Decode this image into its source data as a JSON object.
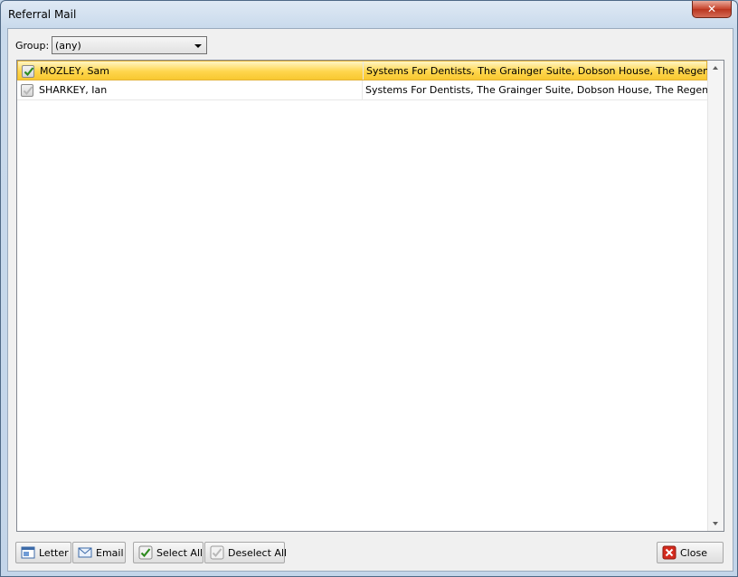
{
  "window": {
    "title": "Referral Mail",
    "close_glyph": "✕"
  },
  "filter": {
    "label": "Group:",
    "selected": "(any)"
  },
  "list": {
    "rows": [
      {
        "checked": true,
        "selected": true,
        "name": "MOZLEY, Sam",
        "address": "Systems For Dentists, The Grainger Suite, Dobson House, The Regent"
      },
      {
        "checked": false,
        "selected": false,
        "name": "SHARKEY, Ian",
        "address": "Systems For Dentists, The Grainger Suite, Dobson House, The Regent"
      }
    ]
  },
  "buttons": {
    "letter": "Letter",
    "email": "Email",
    "select_all": "Select All",
    "deselect_all": "Deselect All",
    "close": "Close"
  },
  "icons": {
    "letter": "letter-icon",
    "email": "email-icon",
    "select_all": "check-icon",
    "deselect_all": "uncheck-icon",
    "close": "close-icon"
  },
  "colors": {
    "selection": "#ffd64d",
    "check_green": "#2e8b20",
    "close_red": "#d42b1e"
  }
}
